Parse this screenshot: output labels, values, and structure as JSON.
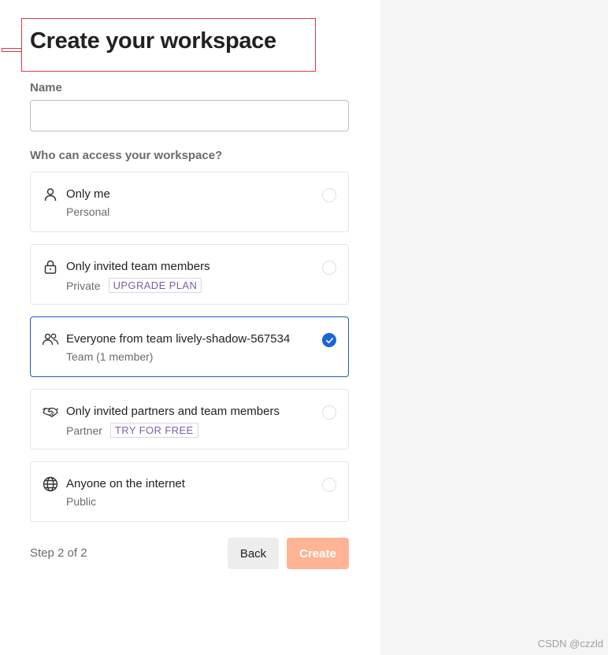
{
  "header": {
    "title": "Create your workspace"
  },
  "form": {
    "name_label": "Name",
    "name_value": "",
    "name_placeholder": "",
    "access_label": "Who can access your workspace?"
  },
  "options": [
    {
      "icon": "person-icon",
      "title": "Only me",
      "subtitle": "Personal",
      "badge": "",
      "selected": false
    },
    {
      "icon": "lock-icon",
      "title": "Only invited team members",
      "subtitle": "Private",
      "badge": "UPGRADE PLAN",
      "selected": false
    },
    {
      "icon": "team-icon",
      "title": "Everyone from team lively-shadow-567534",
      "subtitle": "Team (1 member)",
      "badge": "",
      "selected": true
    },
    {
      "icon": "handshake-icon",
      "title": "Only invited partners and team members",
      "subtitle": "Partner",
      "badge": "TRY FOR FREE",
      "selected": false
    },
    {
      "icon": "globe-icon",
      "title": "Anyone on the internet",
      "subtitle": "Public",
      "badge": "",
      "selected": false
    }
  ],
  "footer": {
    "step": "Step 2 of 2",
    "back_label": "Back",
    "create_label": "Create"
  },
  "watermark": "CSDN @czzld",
  "colors": {
    "accent_selected": "#1c64d8",
    "create_button": "#ffb496",
    "highlight": "#e0393e",
    "badge_text": "#7b5fa8",
    "right_panel": "#f5f5f5"
  }
}
